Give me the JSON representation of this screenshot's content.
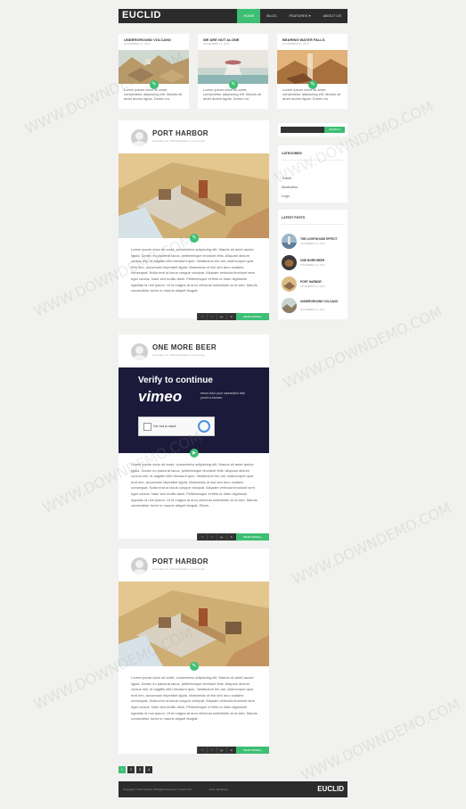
{
  "header": {
    "logo": "EUCLID",
    "nav": [
      "HOME",
      "BLOG",
      "FEATURES",
      "ABOUT US"
    ],
    "features_caret": "▾"
  },
  "featured": [
    {
      "title": "UNDERGROUND VOLCANO",
      "date": "NOVEMBER 12, 2013",
      "excerpt": "Lorem ipsum dolor sit amet, consectetur adipiscing elit. Mauris sit amet auctor ligula. Donec eu."
    },
    {
      "title": "WE ARE NOT ALONE",
      "date": "NOVEMBER 12, 2013",
      "excerpt": "Lorem ipsum dolor sit amet, consectetur adipiscing elit. Mauris sit amet auctor ligula. Donec eu."
    },
    {
      "title": "BEARING WATER FALLS",
      "date": "NOVEMBER 12, 2013",
      "excerpt": "Lorem ipsum dolor sit amet, consectetur adipiscing elit. Mauris sit amet auctor ligula. Donec eu."
    }
  ],
  "posts": [
    {
      "title": "PORT HARBOR",
      "meta": "November 12, 2013   Illustration   2 Comments",
      "body": "Lorem ipsum dolor sit amet, consectetur adipiscing elit. Mauris sit amet auctor ligula. Donec eu placerat lacus, pellentesque tincidunt felis. Aliquam dictum cursus nisi, et sagittis nibh tincidunt quis. Vestibulum leo dui, ullamcorper quis erat nec, accumsan imperdiet ligula. Maecenas ut nisi sed arcu sodales consequat. Nulla erat ut lacus congue volutpat. Aliquam vehicula tincidunt sem eget cursus. Nam sed mollis diam. Pellentesque et felis ut diam dignissim egestas id non ipsum. Ut id magna at arcu vehicula sollicitudin at id odio. Mauris consectetur tortor in mauris aliquet feugiat.",
      "read_more": "READ MORE ▸"
    },
    {
      "title": "ONE MORE BEER",
      "meta": "November 12, 2013   Illustration   2 Comments",
      "video_heading": "Verify to continue",
      "video_brand": "vimeo",
      "video_note": "errors from your connection that you're a human.",
      "captcha_label": "I'm not a robot",
      "body": "Lorem ipsum dolor sit amet, consectetur adipiscing elit. Mauris sit amet auctor ligula. Donec eu placerat lacus, pellentesque tincidunt felis. Aliquam dictum cursus nisi, et sagittis nibh tincidunt quis. Vestibulum leo dui, ullamcorper quis erat nec, accumsan imperdiet ligula. Maecenas ut nisi sed arcu sodales consequat. Nulla erat ut lacus congue volutpat. Aliquam vehicula tincidunt sem eget cursus. Nam sed mollis diam. Pellentesque et felis ut diam dignissim egestas id non ipsum. Ut id magna at arcu vehicula sollicitudin at id odio. Mauris consectetur tortor in mauris aliquet feugiat. Etiam.",
      "read_more": "READ MORE ▸"
    },
    {
      "title": "PORT HARBOR",
      "meta": "November 12, 2013   Illustration   2 Comments",
      "body": "Lorem ipsum dolor sit amet, consectetur adipiscing elit. Mauris sit amet auctor ligula. Donec eu placerat lacus, pellentesque tincidunt felis. Aliquam dictum cursus nisi, et sagittis nibh tincidunt quis. Vestibulum leo dui, ullamcorper quis erat nec, accumsan imperdiet ligula. Maecenas ut nisi sed arcu sodales consequat. Nulla erat ut lacus congue volutpat. Aliquam vehicula tincidunt sem eget cursus. Nam sed mollis diam. Pellentesque et felis ut diam dignissim egestas id non ipsum. Ut id magna at arcu vehicula sollicitudin at id odio. Mauris consectetur tortor in mauris aliquet feugiat.",
      "read_more": "READ MORE ▸"
    }
  ],
  "share": [
    "f",
    "t",
    "g+",
    "in"
  ],
  "sidebar": {
    "search_button": "SEARCH",
    "categories_title": "CATEGORIES",
    "categories": [
      "Travel",
      "Illustration",
      "Logo"
    ],
    "latest_title": "LATEST POSTS",
    "latest": [
      {
        "title": "THE LIGHTHOUSE EFFECT",
        "date": "NOVEMBER 12, 2013"
      },
      {
        "title": "ONE MORE BEER",
        "date": "NOVEMBER 12, 2013"
      },
      {
        "title": "PORT HARBOR",
        "date": "NOVEMBER 12, 2013"
      },
      {
        "title": "UNDERGROUND VOLCANO",
        "date": "NOVEMBER 12, 2013"
      }
    ]
  },
  "pagination": [
    "1",
    "2",
    "3",
    "4"
  ],
  "footer": {
    "copyright": "Copyright © 2013 Euclid. All Rights Reserved. Collect from",
    "link": "Asus Templates",
    "logo": "EUCLID"
  },
  "watermark": "WWW.DOWNDEMO.COM",
  "colors": {
    "accent": "#3dbf73",
    "dark": "#2c2c2c",
    "video_bg": "#1c1a3a"
  }
}
